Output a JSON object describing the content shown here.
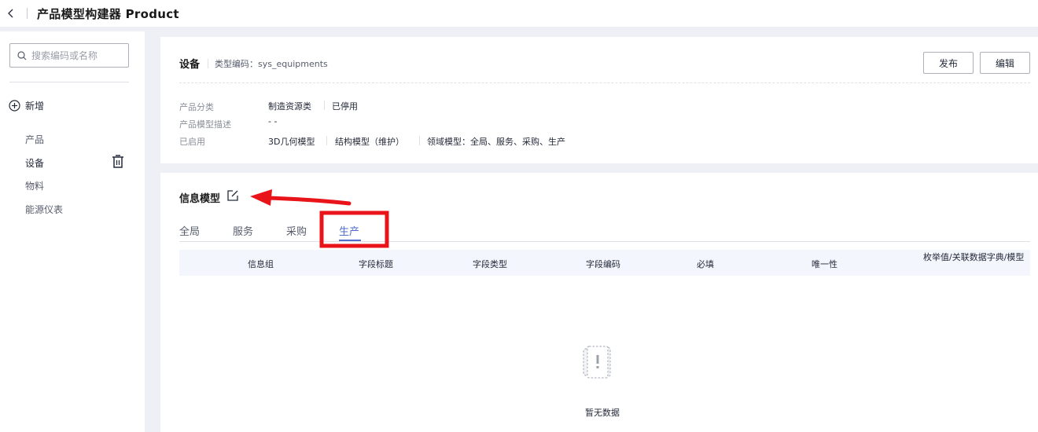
{
  "header": {
    "title": "产品模型构建器 Product"
  },
  "sidebar": {
    "search_placeholder": "搜索编码或名称",
    "add_label": "新增",
    "items": [
      {
        "label": "产品"
      },
      {
        "label": "设备"
      },
      {
        "label": "物料"
      },
      {
        "label": "能源仪表"
      }
    ]
  },
  "detail": {
    "name": "设备",
    "type_code": "类型编码：sys_equipments",
    "publish_label": "发布",
    "edit_label": "编辑",
    "category_label": "产品分类",
    "category_value": "制造资源类",
    "status_value": "已停用",
    "desc_label": "产品模型描述",
    "desc_value": "- -",
    "enabled_label": "已启用",
    "enabled_values": [
      "3D几何模型",
      "结构模型（维护）",
      "领域模型：全局、服务、采购、生产"
    ]
  },
  "info_model": {
    "title": "信息模型",
    "tabs": [
      "全局",
      "服务",
      "采购",
      "生产"
    ],
    "active_tab": "生产",
    "columns": [
      "信息组",
      "字段标题",
      "字段类型",
      "字段编码",
      "必填",
      "唯一性",
      "枚举值/关联数据字典/模型"
    ],
    "empty_text": "暂无数据"
  },
  "colors": {
    "accent": "#526ecc",
    "annotation": "#e8141a"
  },
  "icons": [
    "chevron-left-icon",
    "search-icon",
    "plus-circle-icon",
    "trash-icon",
    "edit-icon",
    "empty-data-icon"
  ]
}
